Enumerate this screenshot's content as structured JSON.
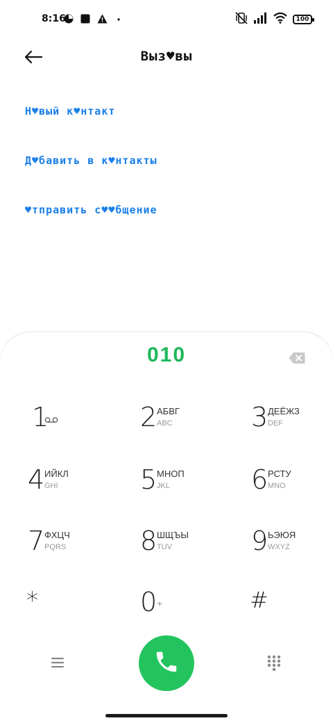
{
  "status_bar": {
    "time": "8:16",
    "battery": "100",
    "icons": [
      "pie-app-icon",
      "stop-square-icon",
      "warning-icon",
      "dot-icon",
      "vibrate-off-icon",
      "signal-icon",
      "wifi-icon",
      "battery-icon"
    ]
  },
  "header": {
    "title": "Выз♥вы",
    "back_icon": "arrow-left-icon"
  },
  "actions": [
    {
      "label": "Н♥вый к♥нтакт"
    },
    {
      "label": "Д♥бавить в к♥нтакты"
    },
    {
      "label": "♥тправить с♥♥бщение"
    }
  ],
  "dialer": {
    "number": "010",
    "keys": [
      {
        "digit": "1",
        "letters": "",
        "latin": "",
        "icon": "voicemail-icon"
      },
      {
        "digit": "2",
        "letters": "АБВГ",
        "latin": "ABC"
      },
      {
        "digit": "3",
        "letters": "ДЕЁЖЗ",
        "latin": "DEF"
      },
      {
        "digit": "4",
        "letters": "ИЙКЛ",
        "latin": "GHI"
      },
      {
        "digit": "5",
        "letters": "МНОП",
        "latin": "JKL"
      },
      {
        "digit": "6",
        "letters": "РСТУ",
        "latin": "MNO"
      },
      {
        "digit": "7",
        "letters": "ФХЦЧ",
        "latin": "PQRS"
      },
      {
        "digit": "8",
        "letters": "ШЩЪЫ",
        "latin": "TUV"
      },
      {
        "digit": "9",
        "letters": "ЬЭЮЯ",
        "latin": "WXYZ"
      },
      {
        "digit": "*",
        "letters": "",
        "latin": ""
      },
      {
        "digit": "0",
        "letters": "+",
        "latin": ""
      },
      {
        "digit": "#",
        "letters": "",
        "latin": ""
      }
    ]
  },
  "colors": {
    "accent_link": "#1a7fe8",
    "dial_number": "#1eb75a",
    "call_button": "#23c45e"
  }
}
